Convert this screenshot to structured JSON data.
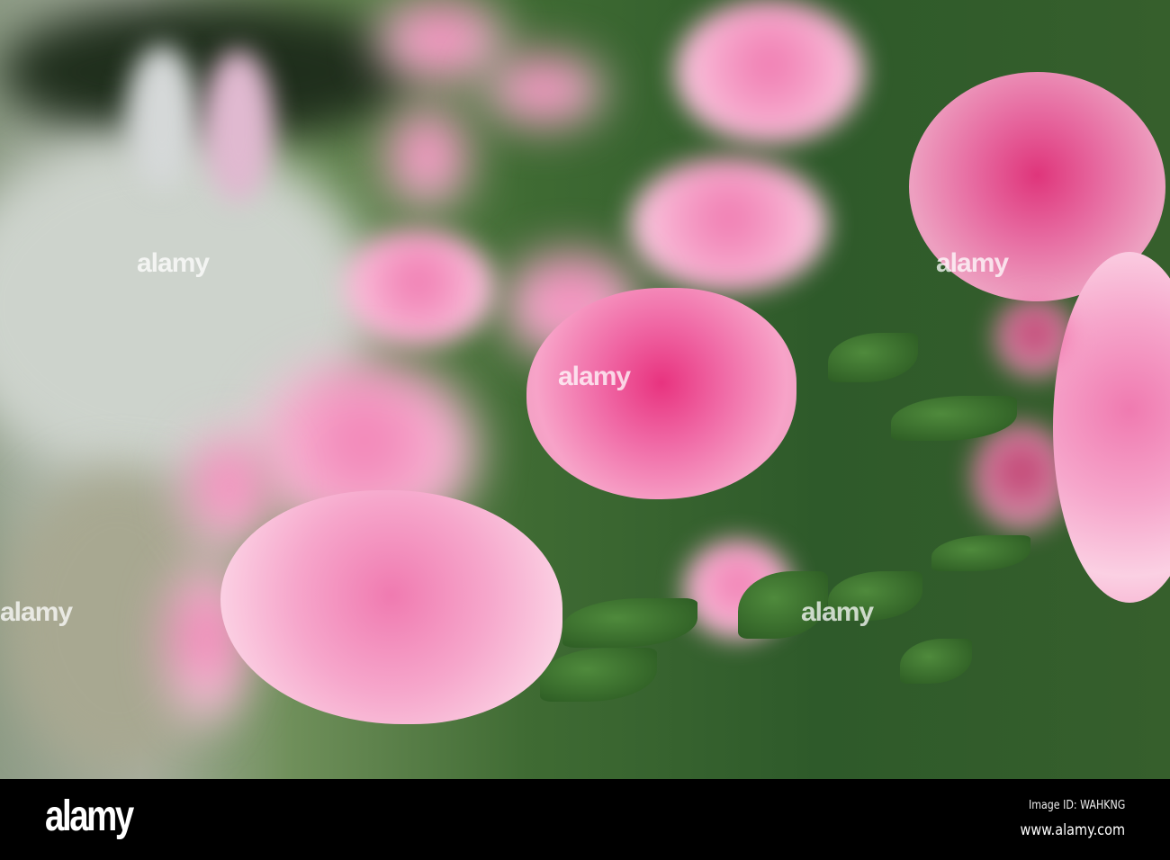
{
  "watermark": {
    "text": "alamy"
  },
  "footer": {
    "logo": "alamy",
    "image_id": "Image ID: WAHKNG",
    "website": "www.alamy.com"
  }
}
